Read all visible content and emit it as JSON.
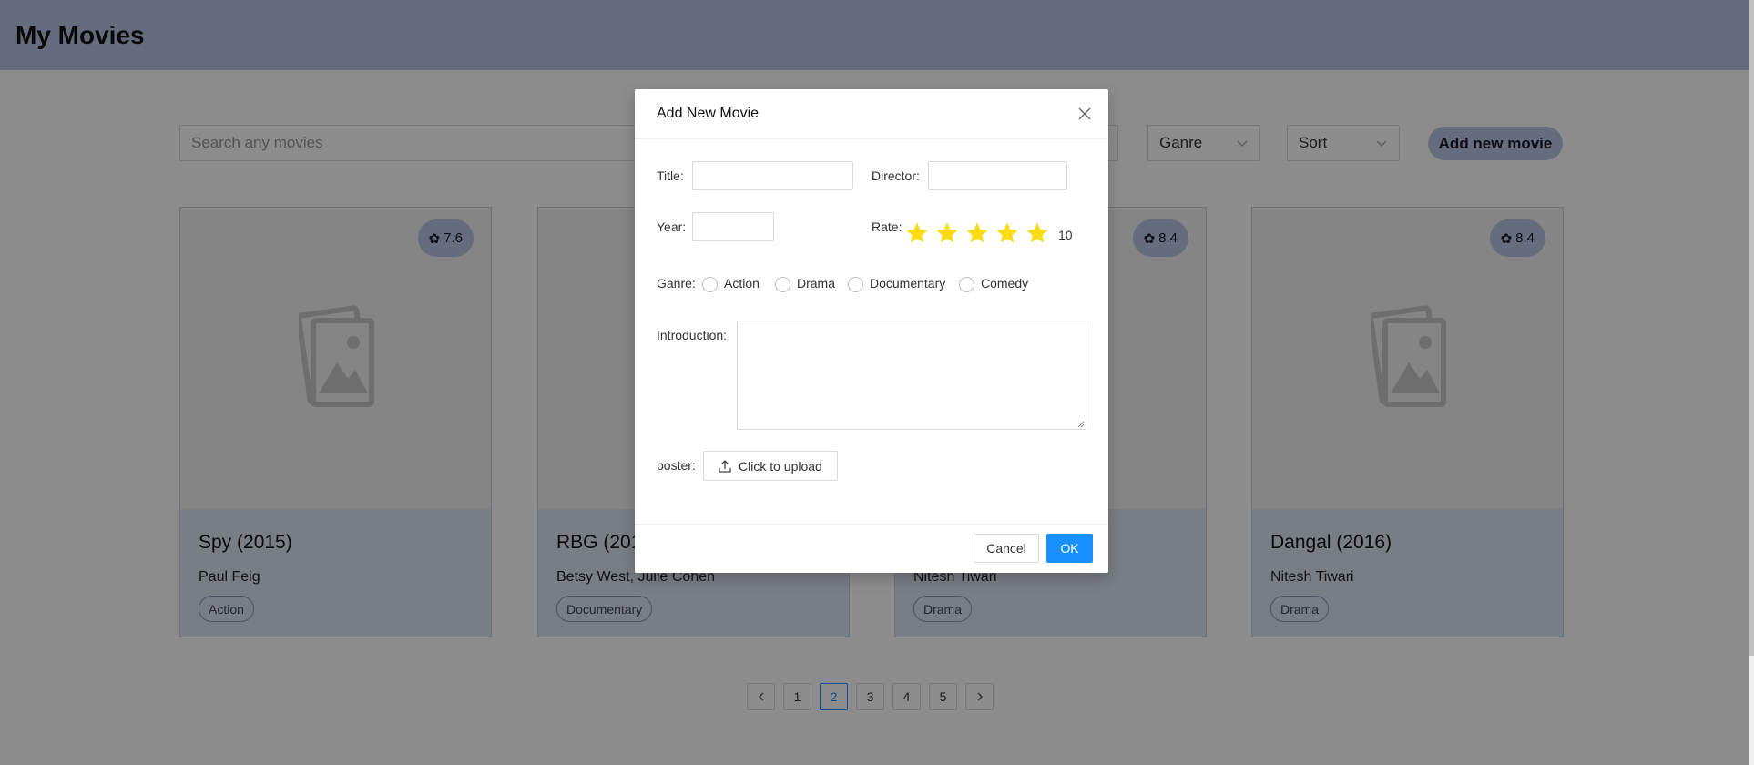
{
  "app": {
    "title": "My Movies"
  },
  "toolbar": {
    "search_placeholder": "Search any movies",
    "genre_select": "Ganre",
    "sort_select": "Sort",
    "add_button": "Add new movie"
  },
  "cards": [
    {
      "title": "Spy (2015)",
      "director": "Paul Feig",
      "genre": "Action",
      "rating": "7.6"
    },
    {
      "title": "RBG (2018)",
      "director": "Betsy West, Julie Cohen",
      "genre": "Documentary",
      "rating": ""
    },
    {
      "title": "",
      "director": "Nitesh Tiwari",
      "genre": "Drama",
      "rating": "8.4"
    },
    {
      "title": "Dangal (2016)",
      "director": "Nitesh Tiwari",
      "genre": "Drama",
      "rating": "8.4"
    }
  ],
  "pagination": {
    "pages": [
      "1",
      "2",
      "3",
      "4",
      "5"
    ],
    "current": "2"
  },
  "modal": {
    "title": "Add New Movie",
    "fields": {
      "title_label": "Title",
      "director_label": "Director",
      "year_label": "Year",
      "rate_label": "Rate",
      "rate_value": "10",
      "rate_stars_filled": 5,
      "rate_stars_total": 5,
      "genre_label": "Ganre",
      "genre_options": [
        "Action",
        "Drama",
        "Documentary",
        "Comedy"
      ],
      "intro_label": "Introduction",
      "poster_label": "poster",
      "upload_button": "Click to upload"
    },
    "cancel_button": "Cancel",
    "ok_button": "OK"
  },
  "colors": {
    "header": "#b8c5e3",
    "card_info": "#dde3f0",
    "primary": "#1890ff",
    "star": "#fadb14"
  }
}
